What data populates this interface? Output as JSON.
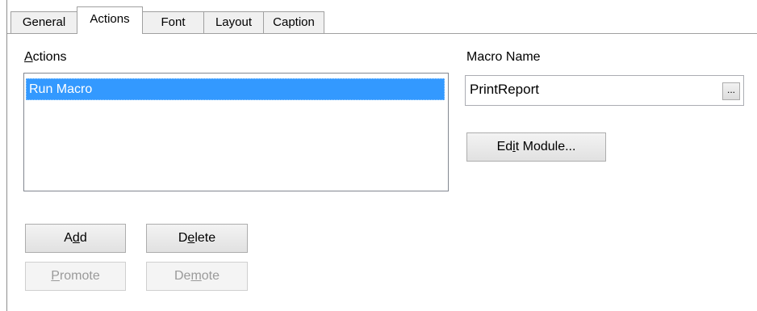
{
  "tabs": [
    {
      "label": "General"
    },
    {
      "label": "Actions"
    },
    {
      "label": "Font"
    },
    {
      "label": "Layout"
    },
    {
      "label": "Caption"
    }
  ],
  "active_tab": "Actions",
  "actions": {
    "label_first": "A",
    "label_rest": "ctions",
    "items": [
      {
        "label": "Run Macro",
        "selected": true
      }
    ]
  },
  "macro": {
    "label": "Macro Name",
    "value": "PrintReport",
    "browse_label": "..."
  },
  "buttons": {
    "edit_module": {
      "pre": "Ed",
      "u": "i",
      "post": "t Module..."
    },
    "add": {
      "pre": "A",
      "u": "d",
      "post": "d"
    },
    "delete": {
      "pre": "D",
      "u": "e",
      "post": "lete"
    },
    "promote": {
      "pre": "",
      "u": "P",
      "post": "romote"
    },
    "demote": {
      "pre": "De",
      "u": "m",
      "post": "ote"
    }
  },
  "colors": {
    "selection": "#3399ff",
    "disabled_text": "#9a9a9a"
  }
}
